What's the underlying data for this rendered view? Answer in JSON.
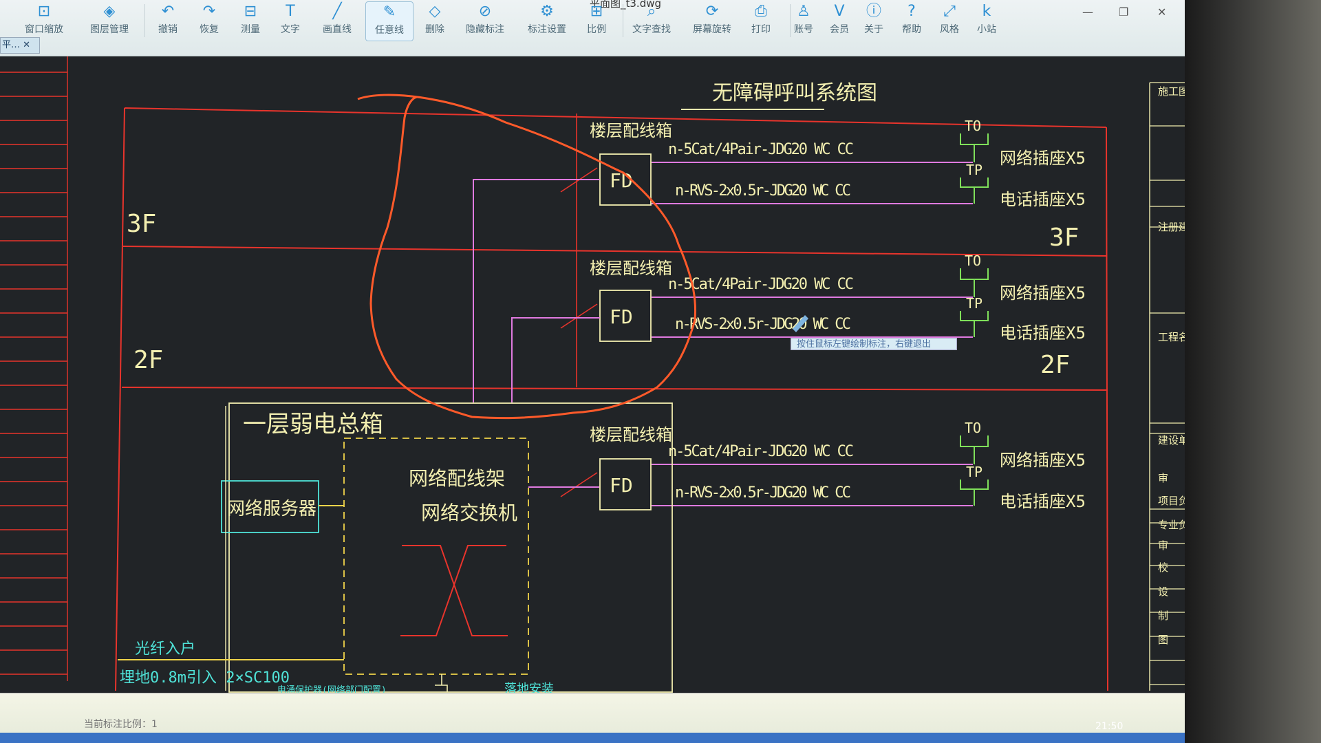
{
  "window": {
    "title": "平面图_t3.dwg",
    "minimize": "—",
    "maximize": "❐",
    "close": "✕"
  },
  "tab": {
    "label": "平…",
    "close": "✕"
  },
  "toolbar": [
    {
      "label": "窗口缩放",
      "icon": "zoom-window-icon",
      "glyph": "⊡"
    },
    {
      "label": "图层管理",
      "icon": "layers-icon",
      "glyph": "◈"
    },
    {
      "label": "撤销",
      "icon": "undo-icon",
      "glyph": "↶"
    },
    {
      "label": "恢复",
      "icon": "redo-icon",
      "glyph": "↷"
    },
    {
      "label": "测量",
      "icon": "ruler-icon",
      "glyph": "⊟"
    },
    {
      "label": "文字",
      "icon": "text-icon",
      "glyph": "T"
    },
    {
      "label": "画直线",
      "icon": "line-icon",
      "glyph": "╱"
    },
    {
      "label": "任意线",
      "icon": "pen-icon",
      "glyph": "✎",
      "active": true
    },
    {
      "label": "删除",
      "icon": "eraser-icon",
      "glyph": "◇"
    },
    {
      "label": "隐藏标注",
      "icon": "hide-eye-icon",
      "glyph": "⊘"
    },
    {
      "label": "标注设置",
      "icon": "annotation-settings-icon",
      "glyph": "⚙"
    },
    {
      "label": "比例",
      "icon": "scale-icon",
      "glyph": "⊞"
    },
    {
      "label": "文字查找",
      "icon": "text-search-icon",
      "glyph": "⌕"
    },
    {
      "label": "屏幕旋转",
      "icon": "rotate-screen-icon",
      "glyph": "⟳"
    },
    {
      "label": "打印",
      "icon": "printer-icon",
      "glyph": "⎙"
    },
    {
      "label": "账号",
      "icon": "user-icon",
      "glyph": "♙"
    },
    {
      "label": "会员",
      "icon": "vip-icon",
      "glyph": "V"
    },
    {
      "label": "关于",
      "icon": "info-icon",
      "glyph": "ⓘ"
    },
    {
      "label": "帮助",
      "icon": "help-icon",
      "glyph": "?"
    },
    {
      "label": "风格",
      "icon": "style-icon",
      "glyph": "⤢"
    },
    {
      "label": "小站",
      "icon": "k-site-icon",
      "glyph": "k"
    }
  ],
  "drawing": {
    "title": "无障碍呼叫系统图",
    "floors": [
      "3F",
      "2F"
    ],
    "panel_label": "楼层配线箱",
    "fd": "FD",
    "cable_net": "n-5Cat/4Pair-JDG20  WC  CC",
    "cable_tel": "n-RVS-2x0.5r-JDG20  WC  CC",
    "to": "TO",
    "tp": "TP",
    "outlet_net": "网络插座X5",
    "outlet_tel": "电话插座X5",
    "main_box": "一层弱电总箱",
    "server": "网络服务器",
    "rack1": "网络配线架",
    "rack2": "网络交换机",
    "fiber": "光纤入户",
    "fiber_note": "埋地0.8m引入 2×SC100",
    "surge": "电涌保护器(网络部门配置)",
    "mount": "落地安装",
    "titleblock": [
      "施工图",
      "注册建",
      "工程名",
      "建设单位",
      "审",
      "项目负",
      "专业负",
      "审",
      "校",
      "设",
      "制",
      "图"
    ],
    "colors": {
      "frame": "#e8342c",
      "pen": "#ff5a2a",
      "cable": "#e07ae0",
      "text": "#f3efb0",
      "symbol": "#7fe05a",
      "cyan": "#4fe3d8",
      "yellow": "#f0d44a"
    }
  },
  "tooltip": "按住鼠标左键绘制标注，右键退出",
  "status": {
    "scale": "当前标注比例：1"
  },
  "taskbar": {
    "clock": "21:50"
  }
}
